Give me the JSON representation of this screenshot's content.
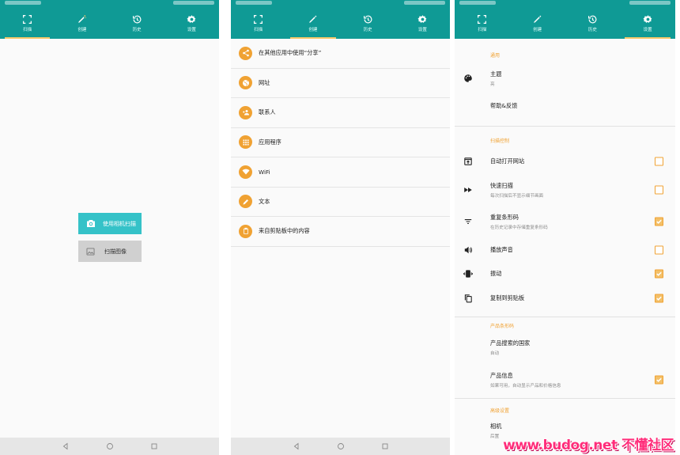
{
  "tabs": {
    "scan": "扫描",
    "create": "创建",
    "history": "历史",
    "settings": "设置"
  },
  "scan_screen": {
    "camera_button": "使用相机扫描",
    "image_button": "扫描图像"
  },
  "create_screen": {
    "items": [
      {
        "label": "在其他应用中使用“分享”",
        "icon": "share-icon"
      },
      {
        "label": "网址",
        "icon": "globe-icon"
      },
      {
        "label": "联系人",
        "icon": "person-add-icon"
      },
      {
        "label": "应用程序",
        "icon": "apps-grid-icon"
      },
      {
        "label": "WiFi",
        "icon": "wifi-icon"
      },
      {
        "label": "文本",
        "icon": "pencil-icon"
      },
      {
        "label": "来自剪贴板中的内容",
        "icon": "clipboard-icon"
      }
    ]
  },
  "settings_screen": {
    "sections": {
      "general": "通用",
      "scan_control": "扫描控制",
      "product_barcode": "产品条形码",
      "advanced": "高级设置"
    },
    "theme": {
      "title": "主题",
      "value": "亮",
      "icon": "palette-icon"
    },
    "help": {
      "title": "帮助&反馈"
    },
    "auto_open": {
      "title": "自动打开网站",
      "icon": "open-in-browser-icon",
      "checked": false
    },
    "fast_scan": {
      "title": "快速扫描",
      "desc": "每次扫描后不显示细节画面",
      "icon": "fast-forward-icon",
      "checked": false
    },
    "duplicate": {
      "title": "重复条形码",
      "desc": "在历史记录中存储重复条形码",
      "icon": "filter-list-icon",
      "checked": true
    },
    "sound": {
      "title": "播放声音",
      "icon": "volume-icon",
      "checked": false
    },
    "vibrate": {
      "title": "振动",
      "icon": "vibrate-icon",
      "checked": true
    },
    "clipboard": {
      "title": "复制到剪贴板",
      "icon": "copy-icon",
      "checked": true
    },
    "country": {
      "title": "产品搜索的国家",
      "value": "自动"
    },
    "product_info": {
      "title": "产品信息",
      "desc": "如果可用，自动显示产品和价格信息",
      "checked": true
    },
    "camera": {
      "title": "相机",
      "value": "后置"
    }
  },
  "watermark": "www.budog.net 不懂社区",
  "colors": {
    "toolbar": "#0f9a95",
    "accent": "#f0a233",
    "camera_button": "#35c2c8",
    "image_button": "#d0d0d0"
  }
}
